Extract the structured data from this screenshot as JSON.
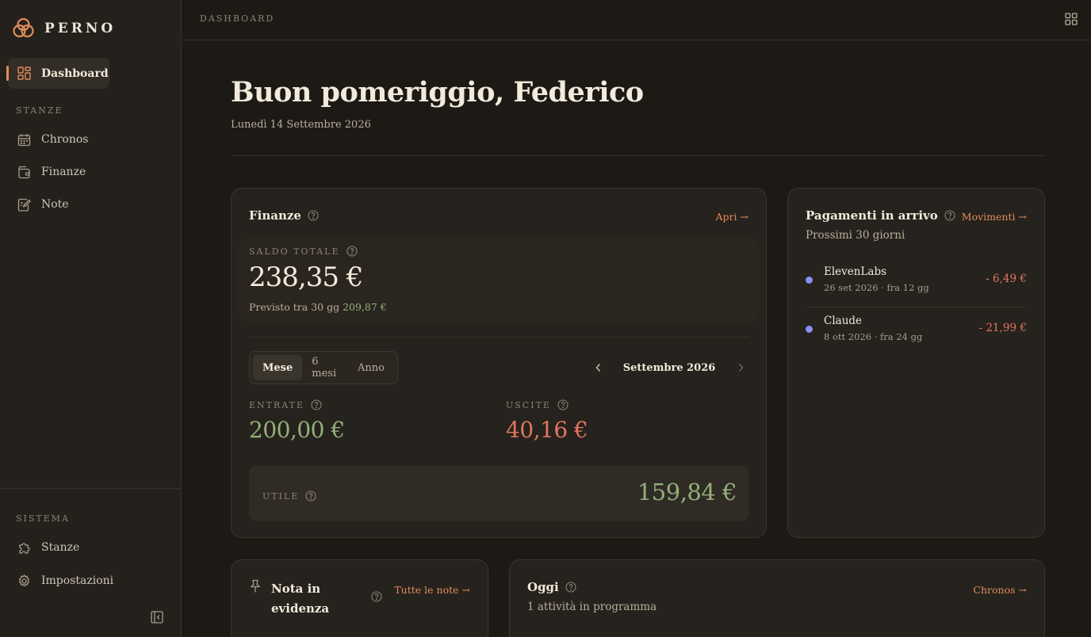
{
  "app": {
    "name": "PERNO",
    "accent": "#e08c5c"
  },
  "sidebar": {
    "active": {
      "label": "Dashboard",
      "icon": "dashboard-icon"
    },
    "section_rooms": "STANZE",
    "rooms": [
      {
        "label": "Chronos",
        "icon": "calendar-icon"
      },
      {
        "label": "Finanze",
        "icon": "wallet-icon"
      },
      {
        "label": "Note",
        "icon": "note-icon"
      }
    ],
    "section_system": "SISTEMA",
    "system": [
      {
        "label": "Stanze",
        "icon": "puzzle-icon"
      },
      {
        "label": "Impostazioni",
        "icon": "gear-icon"
      }
    ]
  },
  "topbar": {
    "breadcrumb": "DASHBOARD"
  },
  "header": {
    "greeting": "Buon pomeriggio, Federico",
    "date": "Lunedì 14 Settembre 2026"
  },
  "finance": {
    "title": "Finanze",
    "open_label": "Apri",
    "balance_label": "SALDO TOTALE",
    "balance": "238,35 €",
    "forecast_prefix": "Previsto tra 30 gg",
    "forecast_value": "209,87 €",
    "periods": [
      "Mese",
      "6 mesi",
      "Anno"
    ],
    "active_period": "Mese",
    "month": "Settembre 2026",
    "income_label": "ENTRATE",
    "income": "200,00 €",
    "expenses_label": "USCITE",
    "expenses": "40,16 €",
    "profit_label": "UTILE",
    "profit": "159,84 €"
  },
  "payments": {
    "title": "Pagamenti in arrivo",
    "link": "Movimenti",
    "subtitle": "Prossimi 30 giorni",
    "items": [
      {
        "name": "ElevenLabs",
        "meta": "26 set 2026 · fra 12 gg",
        "amount": "- 6,49 €"
      },
      {
        "name": "Claude",
        "meta": "8 ott 2026 · fra 24 gg",
        "amount": "- 21,99 €"
      }
    ]
  },
  "pinned_note": {
    "title": "Nota in evidenza",
    "link": "Tutte le note"
  },
  "today": {
    "title": "Oggi",
    "link": "Chronos",
    "subtitle": "1 attività in programma"
  }
}
